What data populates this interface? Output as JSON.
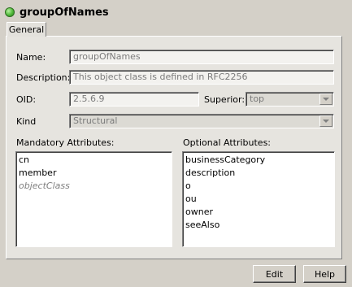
{
  "header": {
    "title": "groupOfNames"
  },
  "tabs": [
    {
      "label": "General"
    }
  ],
  "form": {
    "name_label": "Name:",
    "name_value": "groupOfNames",
    "description_label": "Description:",
    "description_value": "This object class is defined in RFC2256",
    "oid_label": "OID:",
    "oid_value": "2.5.6.9",
    "superior_label": "Superior:",
    "superior_value": "top",
    "kind_label": "Kind",
    "kind_value": "Structural"
  },
  "mandatory": {
    "label": "Mandatory Attributes:",
    "items": [
      "cn",
      "member",
      "objectClass"
    ]
  },
  "optional": {
    "label": "Optional Attributes:",
    "items": [
      "businessCategory",
      "description",
      "o",
      "ou",
      "owner",
      "seeAlso"
    ]
  },
  "buttons": {
    "edit": "Edit",
    "help": "Help"
  },
  "colors": {
    "status_dot": "#4fb83a",
    "panel_bg": "#e6e4df",
    "window_bg": "#d4d0c8"
  }
}
